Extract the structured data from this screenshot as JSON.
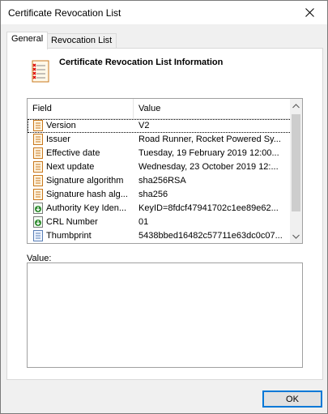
{
  "window": {
    "title": "Certificate Revocation List"
  },
  "tabs": [
    {
      "label": "General"
    },
    {
      "label": "Revocation List"
    }
  ],
  "header": {
    "title": "Certificate Revocation List Information"
  },
  "grid": {
    "columns": [
      "Field",
      "Value"
    ],
    "rows": [
      {
        "field": "Version",
        "value": "V2",
        "icon": "document-icon"
      },
      {
        "field": "Issuer",
        "value": "Road Runner, Rocket Powered Sy...",
        "icon": "document-icon"
      },
      {
        "field": "Effective date",
        "value": "Tuesday, 19 February 2019 12:00...",
        "icon": "document-icon"
      },
      {
        "field": "Next update",
        "value": "Wednesday, 23 October 2019 12:...",
        "icon": "document-icon"
      },
      {
        "field": "Signature algorithm",
        "value": "sha256RSA",
        "icon": "document-icon"
      },
      {
        "field": "Signature hash alg...",
        "value": "sha256",
        "icon": "document-icon"
      },
      {
        "field": "Authority Key Iden...",
        "value": "KeyID=8fdcf47941702c1ee89e62...",
        "icon": "extension-icon"
      },
      {
        "field": "CRL Number",
        "value": "01",
        "icon": "extension-icon"
      },
      {
        "field": "Thumbprint",
        "value": "5438bbed16482c57711e63dc0c07...",
        "icon": "thumbprint-icon"
      }
    ]
  },
  "value": {
    "label": "Value:"
  },
  "footer": {
    "ok_label": "OK"
  },
  "colors": {
    "accent": "#0078d7",
    "row_icon": "#c8781e",
    "ext_icon": "#2e8b2e"
  }
}
